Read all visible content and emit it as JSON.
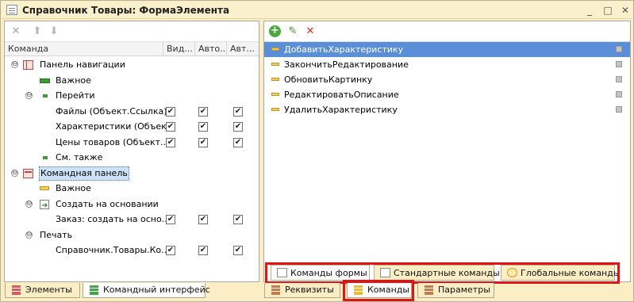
{
  "window": {
    "title": "Справочник Товары: ФормаЭлемента",
    "btn_min": "_",
    "btn_max": "□",
    "btn_close": "✕"
  },
  "left": {
    "toolbar": {
      "delete_icon": "✕",
      "up_icon": "⬆",
      "down_icon": "⬇"
    },
    "columns": [
      "Команда",
      "Вид...",
      "Авто...",
      "Авт..."
    ],
    "rows": [
      {
        "label": "Панель навигации",
        "icon": "navigation-panel-icon"
      },
      {
        "label": "Важное",
        "icon": "green-bar-icon"
      },
      {
        "label": "Перейти",
        "icon": "green-small-icon"
      },
      {
        "label": "Файлы (Объект.Ссылка)",
        "checks": [
          "✔",
          "✔",
          "✔"
        ]
      },
      {
        "label": "Характеристики (Объек...",
        "checks": [
          "✔",
          "✔",
          "✔"
        ]
      },
      {
        "label": "Цены товаров (Объект...",
        "checks": [
          "✔",
          "✔",
          "✔"
        ]
      },
      {
        "label": "См. также",
        "icon": "green-small-icon"
      },
      {
        "label": "Командная панель",
        "icon": "command-panel-icon"
      },
      {
        "label": "Важное",
        "icon": "yellow-bar-icon"
      },
      {
        "label": "Создать на основании",
        "icon": "create-based-icon"
      },
      {
        "label": "Заказ: создать на осно...",
        "checks": [
          "✔",
          "✔",
          "✔"
        ]
      },
      {
        "label": "Печать"
      },
      {
        "label": "Справочник.Товары.Ко...",
        "checks": [
          "✔",
          "✔",
          "✔"
        ]
      }
    ],
    "expanders": [
      "⊖",
      "⊖",
      "⊖",
      "⊖",
      "⊖"
    ],
    "tabs": [
      "Элементы",
      "Командный интерфейс"
    ]
  },
  "right": {
    "toolbar": {
      "add_icon": "+",
      "edit_icon": "✎",
      "delete_icon": "✕"
    },
    "items": [
      "ДобавитьХарактеристику",
      "ЗакончитьРедактирование",
      "ОбновитьКартинку",
      "РедактироватьОписание",
      "УдалитьХарактеристику"
    ],
    "subtabs": [
      "Команды формы",
      "Стандартные команды",
      "Глобальные команды"
    ],
    "tabs": [
      "Реквизиты",
      "Команды",
      "Параметры"
    ]
  },
  "colors": {
    "selection": "#5a8fd8",
    "highlight": "#e01414",
    "window_bg": "#fbeec5"
  }
}
